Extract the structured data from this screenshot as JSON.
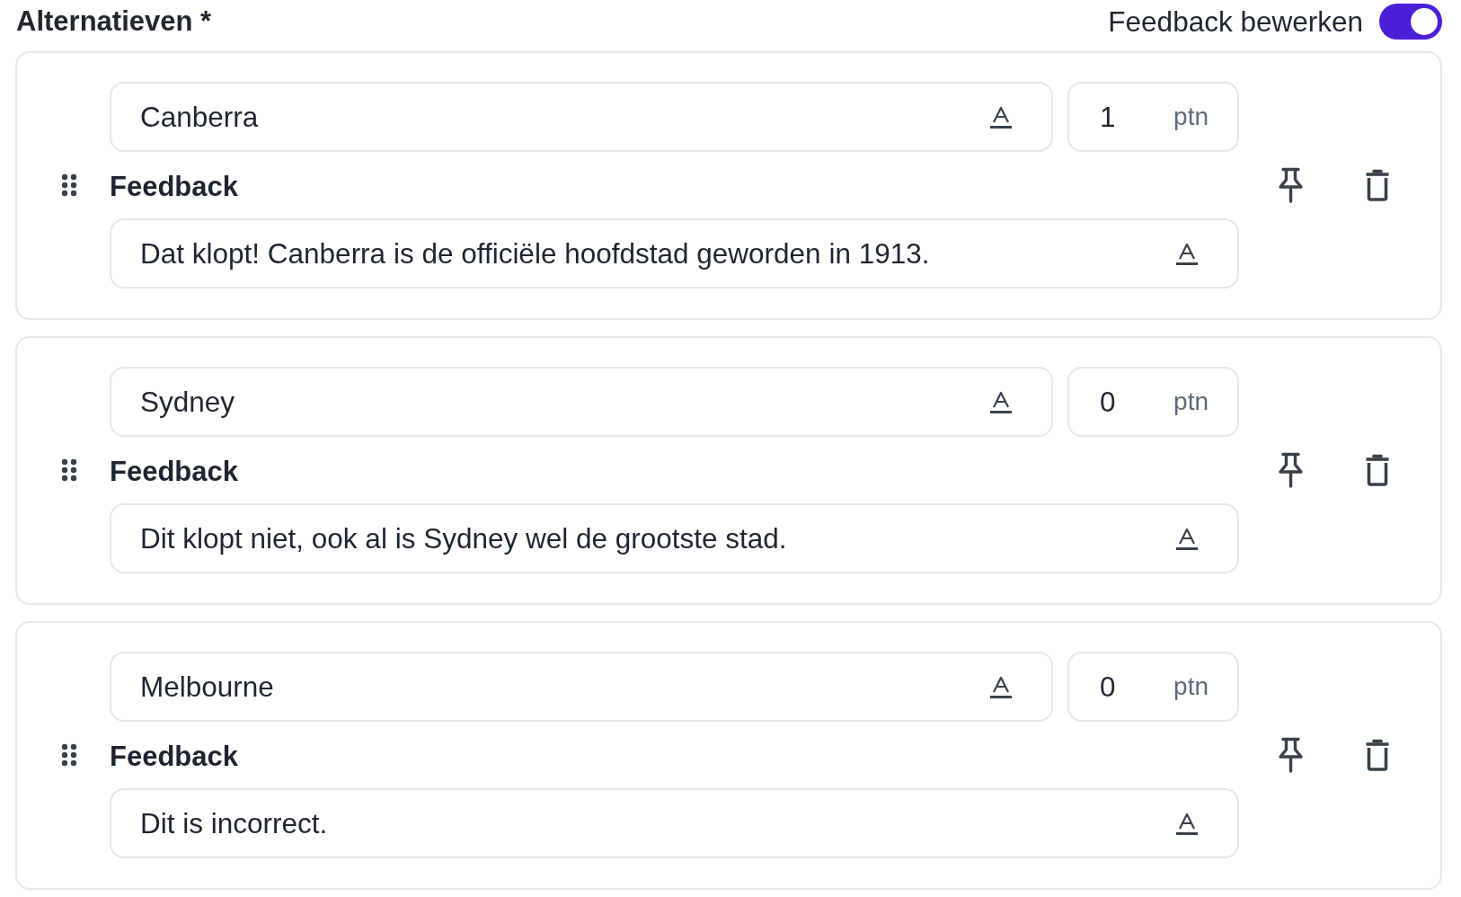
{
  "header": {
    "title": "Alternatieven *",
    "feedback_toggle": {
      "label": "Feedback bewerken",
      "on": true
    }
  },
  "alternatives": [
    {
      "answer": "Canberra",
      "points": "1",
      "points_unit": "ptn",
      "feedback_label": "Feedback",
      "feedback": "Dat klopt! Canberra is de officiële hoofdstad geworden in 1913."
    },
    {
      "answer": "Sydney",
      "points": "0",
      "points_unit": "ptn",
      "feedback_label": "Feedback",
      "feedback": "Dit klopt niet, ook al is Sydney wel de grootste stad."
    },
    {
      "answer": "Melbourne",
      "points": "0",
      "points_unit": "ptn",
      "feedback_label": "Feedback",
      "feedback": "Dit is incorrect."
    }
  ]
}
